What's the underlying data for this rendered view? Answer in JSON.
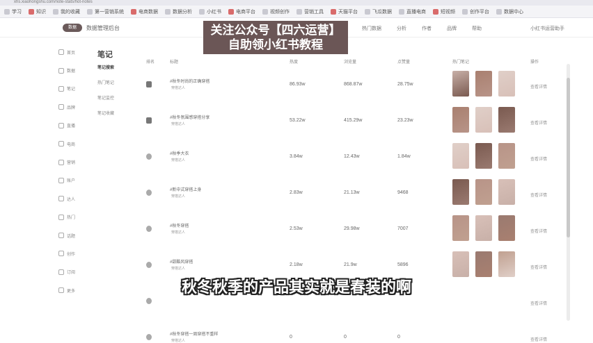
{
  "browser": {
    "url": "xhs.xiaohongshu.com/note-stats/hot-notes",
    "bookmarks": [
      "学习",
      "知识",
      "我的收藏",
      "第一营销系统",
      "电商数据",
      "数据分析",
      "小红书",
      "电商平台",
      "视频创作",
      "营销工具",
      "天猫平台",
      "飞瓜数据",
      "直播电商",
      "短视频",
      "创作平台",
      "数据中心"
    ]
  },
  "topnav": {
    "logo": "数据",
    "site_title": "数据管理后台",
    "items": [
      "热门数据",
      "分析",
      "作者",
      "品牌",
      "帮助"
    ],
    "user": "小红书运营助手"
  },
  "watermark": {
    "line1": "关注公众号【四六运营】",
    "line2": "自助领小红书教程"
  },
  "sidebar": {
    "items": [
      "首页",
      "数据",
      "笔记",
      "品牌",
      "直播",
      "电商",
      "营销",
      "账户",
      "达人",
      "热门",
      "话题",
      "创作",
      "订阅",
      "更多"
    ]
  },
  "subnav": {
    "title": "笔记",
    "items": [
      "笔记搜索",
      "热门笔记",
      "笔记监控",
      "笔记收藏"
    ]
  },
  "table": {
    "headers": [
      "排名",
      "标题",
      "热度",
      "浏览量",
      "点赞量",
      "热门笔记",
      "操作"
    ],
    "rows": [
      {
        "title": "#秋冬时尚的正确穿搭",
        "author": "穿搭达人",
        "heat": "86.93w",
        "views": "868.87w",
        "likes": "28.75w",
        "op": "查看详情"
      },
      {
        "title": "#秋冬氛围感穿搭分享",
        "author": "穿搭达人",
        "heat": "53.22w",
        "views": "415.29w",
        "likes": "23.23w",
        "op": "查看详情"
      },
      {
        "title": "#秋季大衣",
        "author": "穿搭达人",
        "heat": "3.84w",
        "views": "12.43w",
        "likes": "1.84w",
        "op": "查看详情"
      },
      {
        "title": "#新中式穿搭上身",
        "author": "穿搭达人",
        "heat": "2.83w",
        "views": "21.13w",
        "likes": "9468",
        "op": "查看详情"
      },
      {
        "title": "#秋冬穿搭",
        "author": "穿搭达人",
        "heat": "2.53w",
        "views": "29.98w",
        "likes": "7007",
        "op": "查看详情"
      },
      {
        "title": "#甜酷风穿搭",
        "author": "穿搭达人",
        "heat": "2.18w",
        "views": "21.9w",
        "likes": "5896",
        "op": "查看详情"
      },
      {
        "title": "",
        "author": "",
        "heat": "",
        "views": "",
        "likes": "",
        "op": "查看详情"
      },
      {
        "title": "#秋冬穿搭一周穿搭不重样",
        "author": "穿搭达人",
        "heat": "0",
        "views": "0",
        "likes": "0",
        "op": "查看详情"
      }
    ]
  },
  "thumb_colors": [
    "#c8b0a8",
    "#a98070",
    "#e0cfc8",
    "#7a5a50",
    "#b89488",
    "#d8c0b8",
    "#9a7a70",
    "#c0a090"
  ],
  "subtitle": "秋冬秋季的产品其实就是春装的啊"
}
